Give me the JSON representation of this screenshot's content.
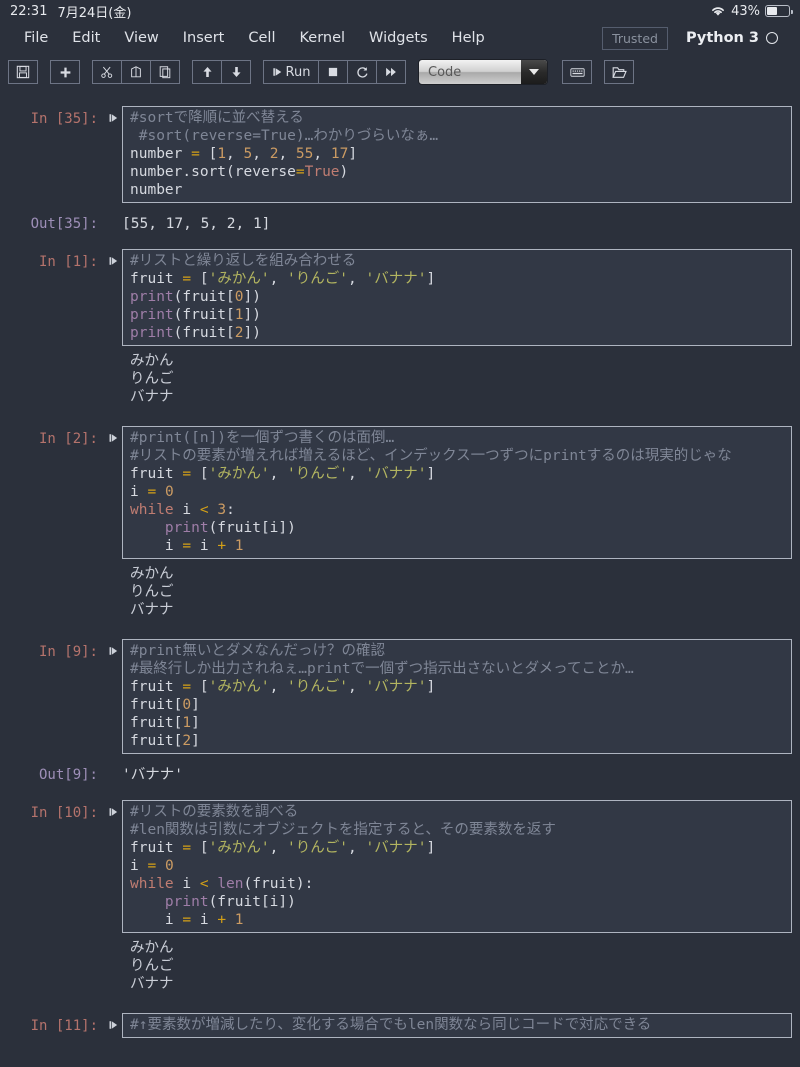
{
  "status_bar": {
    "time": "22:31",
    "date": "7月24日(金)",
    "battery_percent": "43%",
    "wifi_icon": "wifi-icon",
    "battery_icon": "battery-icon"
  },
  "menu_bar": {
    "items": [
      "File",
      "Edit",
      "View",
      "Insert",
      "Cell",
      "Kernel",
      "Widgets",
      "Help"
    ],
    "trusted_label": "Trusted",
    "kernel_name": "Python 3",
    "kernel_status_icon": "kernel-idle-circle-icon"
  },
  "toolbar": {
    "save_icon": "floppy-disk-icon",
    "add_icon": "plus-icon",
    "cut_icon": "scissors-icon",
    "copy_icon": "copy-icon",
    "paste_icon": "paste-icon",
    "move_up_icon": "arrow-up-icon",
    "move_down_icon": "arrow-down-icon",
    "run_label": "Run",
    "run_icon": "run-icon",
    "stop_icon": "stop-square-icon",
    "restart_icon": "restart-circular-arrow-icon",
    "restart_run_all_icon": "fast-forward-icon",
    "cell_type_value": "Code",
    "cell_type_arrow_icon": "chevron-down-icon",
    "command_palette_icon": "keyboard-icon",
    "open_folder_icon": "open-folder-icon"
  },
  "notebook": {
    "cells": [
      {
        "prompt": "In [35]:",
        "prompt_type": "in",
        "lines": [
          [
            {
              "t": "#sortで降順に並べ替える",
              "c": "c"
            }
          ],
          [
            {
              "t": " #sort(reverse=True)…わかりづらいなぁ…",
              "c": "c"
            }
          ],
          [
            {
              "t": "number ",
              "c": "p"
            },
            {
              "t": "=",
              "c": "op"
            },
            {
              "t": " [",
              "c": "p"
            },
            {
              "t": "1",
              "c": "n"
            },
            {
              "t": ", ",
              "c": "p"
            },
            {
              "t": "5",
              "c": "n"
            },
            {
              "t": ", ",
              "c": "p"
            },
            {
              "t": "2",
              "c": "n"
            },
            {
              "t": ", ",
              "c": "p"
            },
            {
              "t": "55",
              "c": "n"
            },
            {
              "t": ", ",
              "c": "p"
            },
            {
              "t": "17",
              "c": "n"
            },
            {
              "t": "]",
              "c": "p"
            }
          ],
          [
            {
              "t": "number.sort(reverse",
              "c": "p"
            },
            {
              "t": "=",
              "c": "op"
            },
            {
              "t": "True",
              "c": "k"
            },
            {
              "t": ")",
              "c": "p"
            }
          ],
          [
            {
              "t": "number",
              "c": "p"
            }
          ]
        ],
        "outputs": [
          {
            "kind": "result",
            "prompt": "Out[35]:",
            "text": "[55, 17, 5, 2, 1]"
          }
        ]
      },
      {
        "prompt": "In [1]:",
        "prompt_type": "in",
        "lines": [
          [
            {
              "t": "#リストと繰り返しを組み合わせる",
              "c": "c"
            }
          ],
          [
            {
              "t": "fruit ",
              "c": "p"
            },
            {
              "t": "=",
              "c": "op"
            },
            {
              "t": " [",
              "c": "p"
            },
            {
              "t": "'みかん'",
              "c": "s"
            },
            {
              "t": ", ",
              "c": "p"
            },
            {
              "t": "'りんご'",
              "c": "s"
            },
            {
              "t": ", ",
              "c": "p"
            },
            {
              "t": "'バナナ'",
              "c": "s"
            },
            {
              "t": "]",
              "c": "p"
            }
          ],
          [
            {
              "t": "print",
              "c": "b"
            },
            {
              "t": "(fruit[",
              "c": "p"
            },
            {
              "t": "0",
              "c": "n"
            },
            {
              "t": "])",
              "c": "p"
            }
          ],
          [
            {
              "t": "print",
              "c": "b"
            },
            {
              "t": "(fruit[",
              "c": "p"
            },
            {
              "t": "1",
              "c": "n"
            },
            {
              "t": "])",
              "c": "p"
            }
          ],
          [
            {
              "t": "print",
              "c": "b"
            },
            {
              "t": "(fruit[",
              "c": "p"
            },
            {
              "t": "2",
              "c": "n"
            },
            {
              "t": "])",
              "c": "p"
            }
          ]
        ],
        "outputs": [
          {
            "kind": "stream",
            "text": "みかん\nりんご\nバナナ"
          }
        ]
      },
      {
        "prompt": "In [2]:",
        "prompt_type": "in",
        "lines": [
          [
            {
              "t": "#print([n])を一個ずつ書くのは面倒…",
              "c": "c"
            }
          ],
          [
            {
              "t": "#リストの要素が増えれば増えるほど、インデックス一つずつにprintするのは現実的じゃな",
              "c": "c"
            }
          ],
          [
            {
              "t": "fruit ",
              "c": "p"
            },
            {
              "t": "=",
              "c": "op"
            },
            {
              "t": " [",
              "c": "p"
            },
            {
              "t": "'みかん'",
              "c": "s"
            },
            {
              "t": ", ",
              "c": "p"
            },
            {
              "t": "'りんご'",
              "c": "s"
            },
            {
              "t": ", ",
              "c": "p"
            },
            {
              "t": "'バナナ'",
              "c": "s"
            },
            {
              "t": "]",
              "c": "p"
            }
          ],
          [
            {
              "t": "i ",
              "c": "p"
            },
            {
              "t": "=",
              "c": "op"
            },
            {
              "t": " ",
              "c": "p"
            },
            {
              "t": "0",
              "c": "n"
            }
          ],
          [
            {
              "t": "while",
              "c": "k"
            },
            {
              "t": " i ",
              "c": "p"
            },
            {
              "t": "<",
              "c": "op"
            },
            {
              "t": " ",
              "c": "p"
            },
            {
              "t": "3",
              "c": "n"
            },
            {
              "t": ":",
              "c": "p"
            }
          ],
          [
            {
              "t": "    ",
              "c": "p"
            },
            {
              "t": "print",
              "c": "b"
            },
            {
              "t": "(fruit[i])",
              "c": "p"
            }
          ],
          [
            {
              "t": "    i ",
              "c": "p"
            },
            {
              "t": "=",
              "c": "op"
            },
            {
              "t": " i ",
              "c": "p"
            },
            {
              "t": "+",
              "c": "op"
            },
            {
              "t": " ",
              "c": "p"
            },
            {
              "t": "1",
              "c": "n"
            }
          ]
        ],
        "outputs": [
          {
            "kind": "stream",
            "text": "みかん\nりんご\nバナナ"
          }
        ]
      },
      {
        "prompt": "In [9]:",
        "prompt_type": "in",
        "lines": [
          [
            {
              "t": "#print無いとダメなんだっけ？の確認",
              "c": "c"
            }
          ],
          [
            {
              "t": "#最終行しか出力されねぇ…printで一個ずつ指示出さないとダメってことか…",
              "c": "c"
            }
          ],
          [
            {
              "t": "fruit ",
              "c": "p"
            },
            {
              "t": "=",
              "c": "op"
            },
            {
              "t": " [",
              "c": "p"
            },
            {
              "t": "'みかん'",
              "c": "s"
            },
            {
              "t": ", ",
              "c": "p"
            },
            {
              "t": "'りんご'",
              "c": "s"
            },
            {
              "t": ", ",
              "c": "p"
            },
            {
              "t": "'バナナ'",
              "c": "s"
            },
            {
              "t": "]",
              "c": "p"
            }
          ],
          [
            {
              "t": "fruit[",
              "c": "p"
            },
            {
              "t": "0",
              "c": "n"
            },
            {
              "t": "]",
              "c": "p"
            }
          ],
          [
            {
              "t": "fruit[",
              "c": "p"
            },
            {
              "t": "1",
              "c": "n"
            },
            {
              "t": "]",
              "c": "p"
            }
          ],
          [
            {
              "t": "fruit[",
              "c": "p"
            },
            {
              "t": "2",
              "c": "n"
            },
            {
              "t": "]",
              "c": "p"
            }
          ]
        ],
        "outputs": [
          {
            "kind": "result",
            "prompt": "Out[9]:",
            "text": "'バナナ'"
          }
        ]
      },
      {
        "prompt": "In [10]:",
        "prompt_type": "in",
        "lines": [
          [
            {
              "t": "#リストの要素数を調べる",
              "c": "c"
            }
          ],
          [
            {
              "t": "#len関数は引数にオブジェクトを指定すると、その要素数を返す",
              "c": "c"
            }
          ],
          [
            {
              "t": "fruit ",
              "c": "p"
            },
            {
              "t": "=",
              "c": "op"
            },
            {
              "t": " [",
              "c": "p"
            },
            {
              "t": "'みかん'",
              "c": "s"
            },
            {
              "t": ", ",
              "c": "p"
            },
            {
              "t": "'りんご'",
              "c": "s"
            },
            {
              "t": ", ",
              "c": "p"
            },
            {
              "t": "'バナナ'",
              "c": "s"
            },
            {
              "t": "]",
              "c": "p"
            }
          ],
          [
            {
              "t": "i ",
              "c": "p"
            },
            {
              "t": "=",
              "c": "op"
            },
            {
              "t": " ",
              "c": "p"
            },
            {
              "t": "0",
              "c": "n"
            }
          ],
          [
            {
              "t": "while",
              "c": "k"
            },
            {
              "t": " i ",
              "c": "p"
            },
            {
              "t": "<",
              "c": "op"
            },
            {
              "t": " ",
              "c": "p"
            },
            {
              "t": "len",
              "c": "b"
            },
            {
              "t": "(fruit):",
              "c": "p"
            }
          ],
          [
            {
              "t": "    ",
              "c": "p"
            },
            {
              "t": "print",
              "c": "b"
            },
            {
              "t": "(fruit[i])",
              "c": "p"
            }
          ],
          [
            {
              "t": "    i ",
              "c": "p"
            },
            {
              "t": "=",
              "c": "op"
            },
            {
              "t": " i ",
              "c": "p"
            },
            {
              "t": "+",
              "c": "op"
            },
            {
              "t": " ",
              "c": "p"
            },
            {
              "t": "1",
              "c": "n"
            }
          ]
        ],
        "outputs": [
          {
            "kind": "stream",
            "text": "みかん\nりんご\nバナナ"
          }
        ]
      },
      {
        "prompt": "In [11]:",
        "prompt_type": "in",
        "lines": [
          [
            {
              "t": "#↑要素数が増減したり、変化する場合でもlen関数なら同じコードで対応できる",
              "c": "c"
            }
          ]
        ],
        "outputs": []
      }
    ]
  },
  "colors": {
    "background": "#2b303b",
    "cell_background": "#323845",
    "cell_border": "#aeb4c0",
    "text": "#d6d9e0",
    "comment": "#7f8696",
    "string": "#b3b560",
    "number": "#cb9b63",
    "keyword": "#c07d72",
    "builtin": "#9f7ea8",
    "operator": "#d4a017",
    "in_prompt": "#b5736c",
    "out_prompt": "#9e8fb8"
  }
}
